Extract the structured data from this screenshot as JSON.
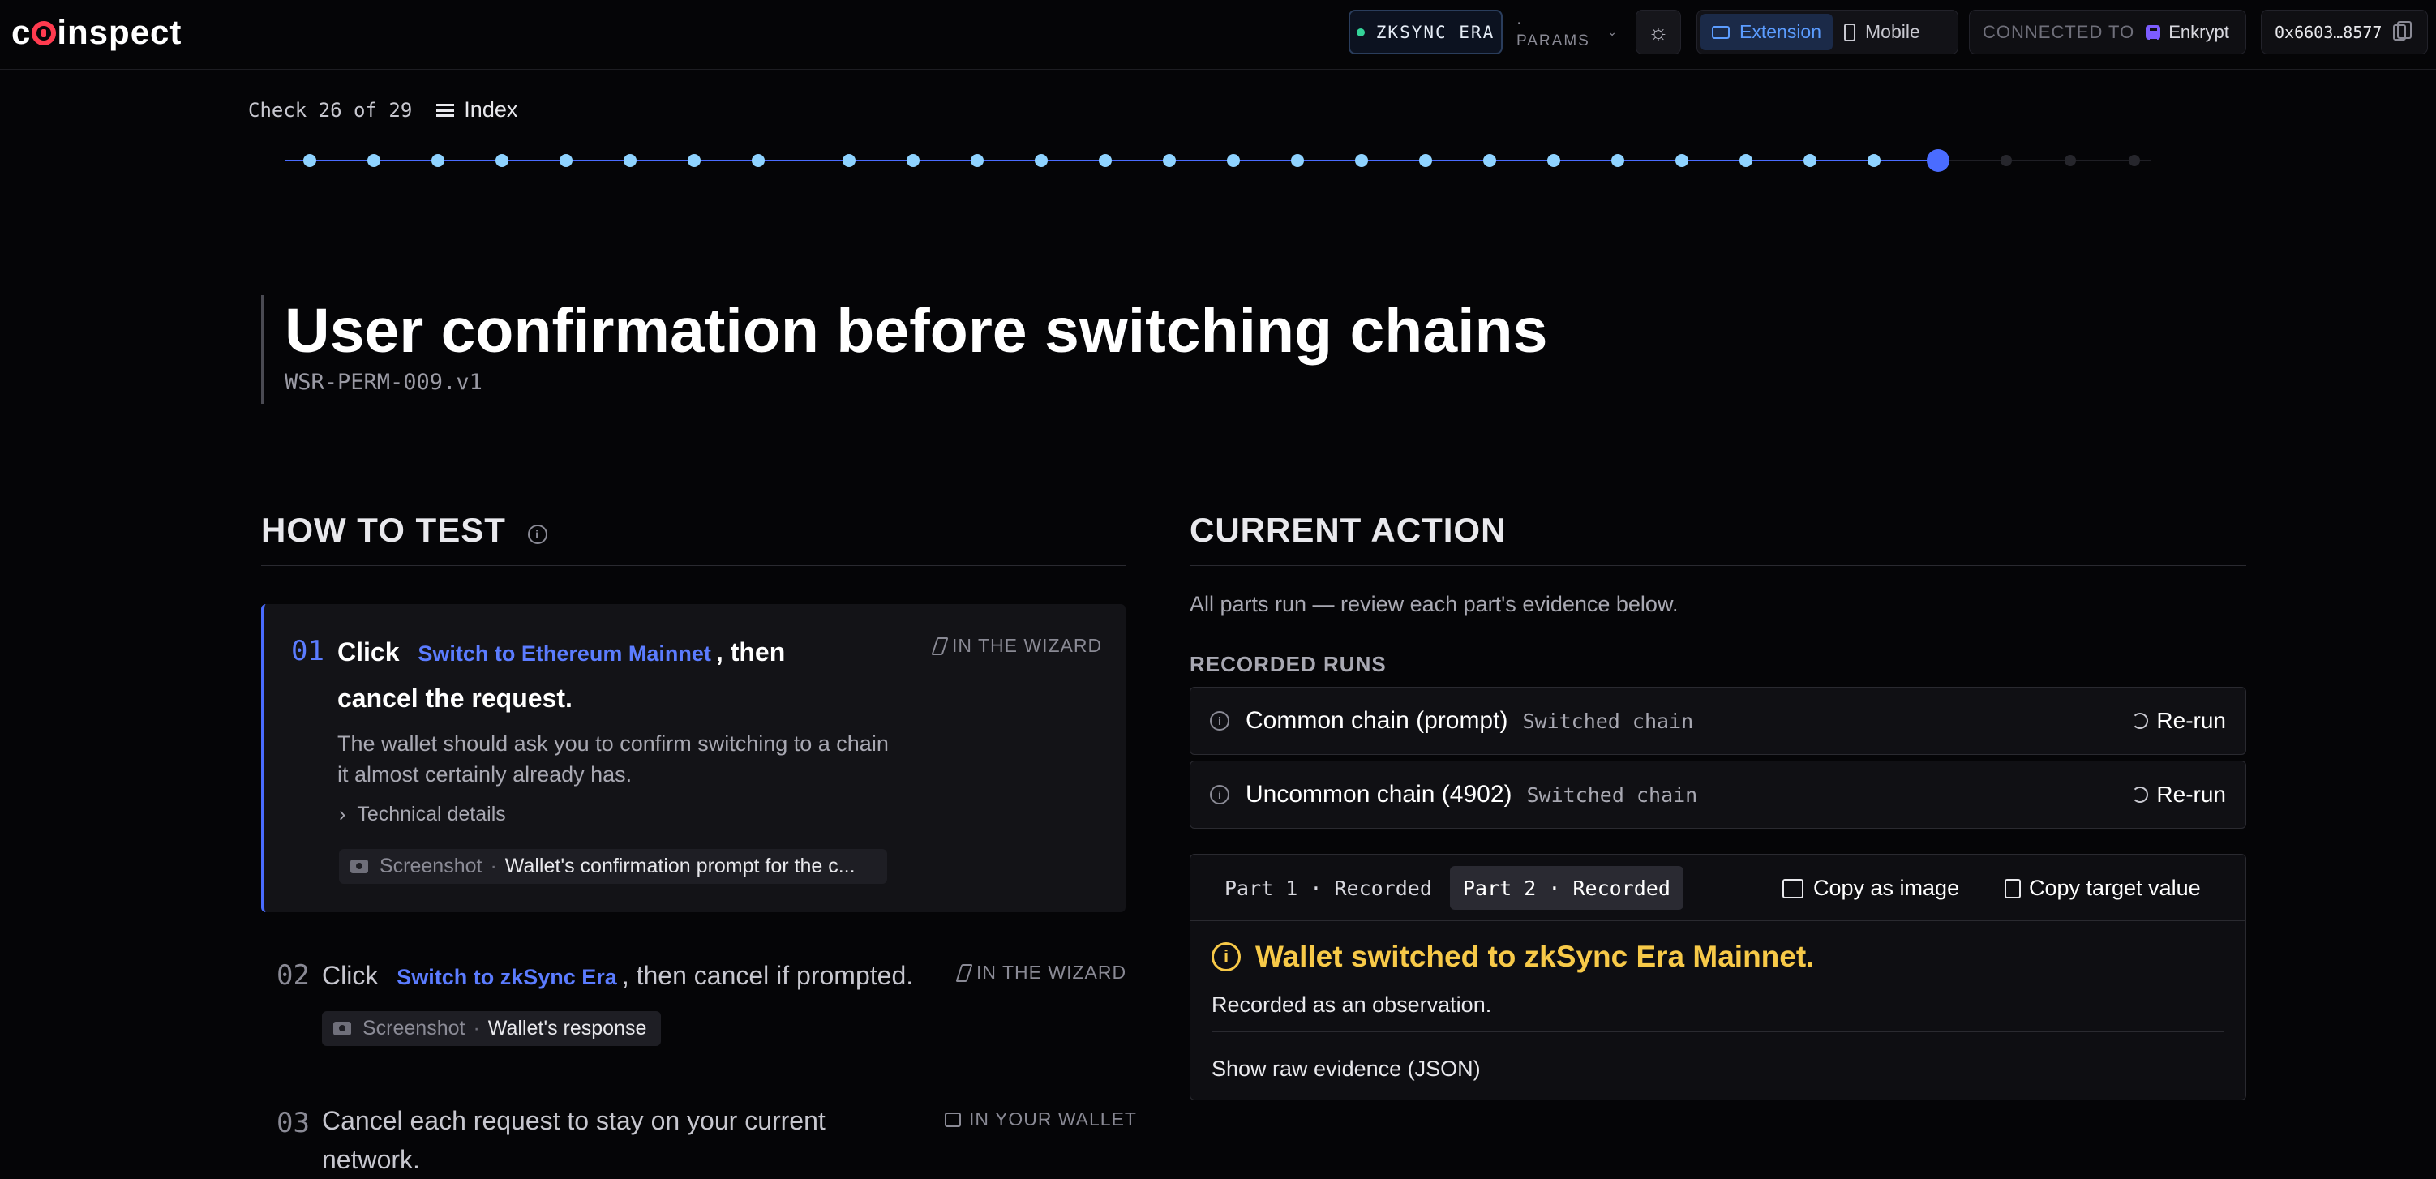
{
  "app": {
    "logo_text": "coinspect"
  },
  "topbar": {
    "network": "ZKSYNC ERA",
    "params_label": "· PARAMS",
    "modes": [
      {
        "label": "Extension",
        "active": true
      },
      {
        "label": "Mobile",
        "active": false
      }
    ],
    "connected_label": "CONNECTED TO",
    "wallet_name": "Enkrypt",
    "address": "0x6603…8577"
  },
  "progress": {
    "check_label": "Check 26 of 29",
    "index_label": "Index",
    "total_steps": 29,
    "current_step": 26
  },
  "check": {
    "title": "User confirmation before switching chains",
    "id": "WSR-PERM-009.v1"
  },
  "how_to_test": {
    "heading": "HOW TO TEST",
    "steps": [
      {
        "num": "01",
        "prefix": "Click",
        "button": "Switch to Ethereum Mainnet",
        "suffix": ", then cancel the request.",
        "where": "IN THE WIZARD",
        "description": "The wallet should ask you to confirm switching to a chain it almost certainly already has.",
        "technical_details": "Technical details",
        "screenshot_label": "Screenshot",
        "screenshot_value": "Wallet's confirmation prompt for the c..."
      },
      {
        "num": "02",
        "prefix": "Click",
        "button": "Switch to zkSync Era",
        "suffix": ", then cancel if prompted.",
        "where": "IN THE WIZARD",
        "screenshot_label": "Screenshot",
        "screenshot_value": "Wallet's response"
      },
      {
        "num": "03",
        "text": "Cancel each request to stay on your current network.",
        "where": "IN YOUR WALLET"
      }
    ]
  },
  "current_action": {
    "heading": "CURRENT ACTION",
    "summary": "All parts run — review each part's evidence below.",
    "recorded_runs_label": "RECORDED RUNS",
    "runs": [
      {
        "name": "Common chain (prompt)",
        "status": "Switched chain",
        "action": "Re-run"
      },
      {
        "name": "Uncommon chain (4902)",
        "status": "Switched chain",
        "action": "Re-run"
      }
    ],
    "evidence": {
      "tabs": [
        {
          "label": "Part 1 · Recorded",
          "active": false
        },
        {
          "label": "Part 2 · Recorded",
          "active": true
        }
      ],
      "copy_image": "Copy as image",
      "copy_target": "Copy target value",
      "result": "Wallet switched to zkSync Era Mainnet.",
      "note": "Recorded as an observation.",
      "raw_label": "Show raw evidence (JSON)"
    }
  },
  "colors": {
    "accent": "#5b7cff",
    "warning": "#f7c948",
    "connected_dot": "#34d399",
    "done_dot": "#8fd3ff"
  }
}
